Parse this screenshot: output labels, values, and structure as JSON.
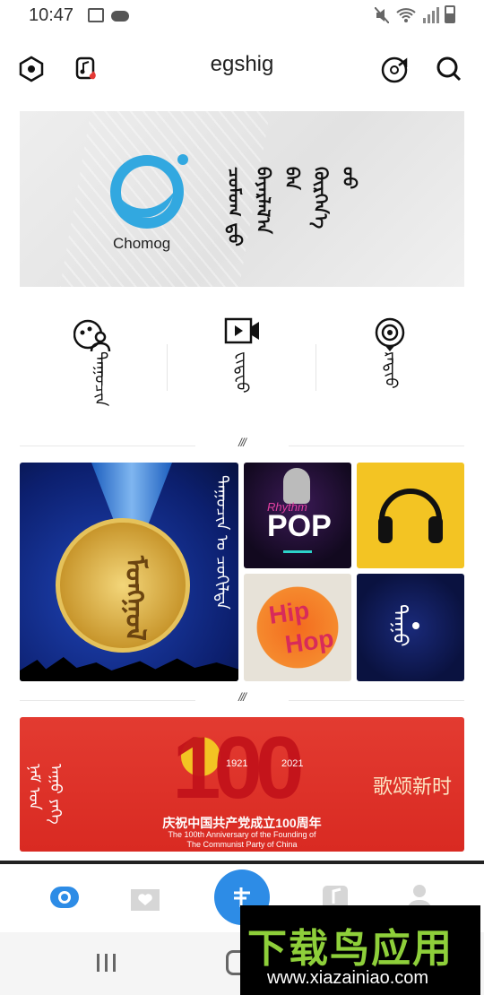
{
  "status": {
    "time": "10:47"
  },
  "app": {
    "title": "egshig"
  },
  "banner": {
    "logo_label": "Chomog",
    "text": "ᠴᠣᠮᠣᠭ ᠳ᠋ᠤ ᠪᠠᠶᠠᠷᠯᠠᠯ᠎ᠠ ᠪᠡᠨ ᠬᠦᠷᠭᠡᠨ᠎ᠡ ᠦᠦ"
  },
  "quick": [
    {
      "label": "ᠳᠠᠭᠤᠴᠢᠨ"
    },
    {
      "label": "ᠸᠢᠳᠧᠤ"
    },
    {
      "label": "ᠷᠠᠳᠢᠤ"
    }
  ],
  "section_mark": "///",
  "tiles": {
    "medal": {
      "caption": "ᠳᠠᠭᠤᠴᠢᠨ ᠤ ᠴᠣᠬᠢᠯᠲᠠ",
      "medal_text": "ᠮᠣᠩᠭᠣᠯ"
    },
    "pop": {
      "text": "POP",
      "script": "Rhythm"
    },
    "hiphop": {
      "line1": "Hip",
      "line2": "Hop"
    },
    "dark": {
      "text": "ᠳᠠᠭᠤ"
    }
  },
  "banner2": {
    "mong": "ᠨᠠᠮ ᠤᠨ ᠠᠭᠤ ᠶᠡᠬᠡ",
    "y1": "1921",
    "y2": "2021",
    "num": "100",
    "zh_right": "歌颂新时",
    "zh_title": "庆祝中国共产党成立100周年",
    "en1": "The 100th Anniversary of the Founding of",
    "en2": "The Communist Party of China"
  },
  "watermark": {
    "big": "下载鸟应用",
    "url": "www.xiazainiao.com"
  },
  "colors": {
    "accent": "#2d8ce6",
    "red": "#d92a22"
  }
}
